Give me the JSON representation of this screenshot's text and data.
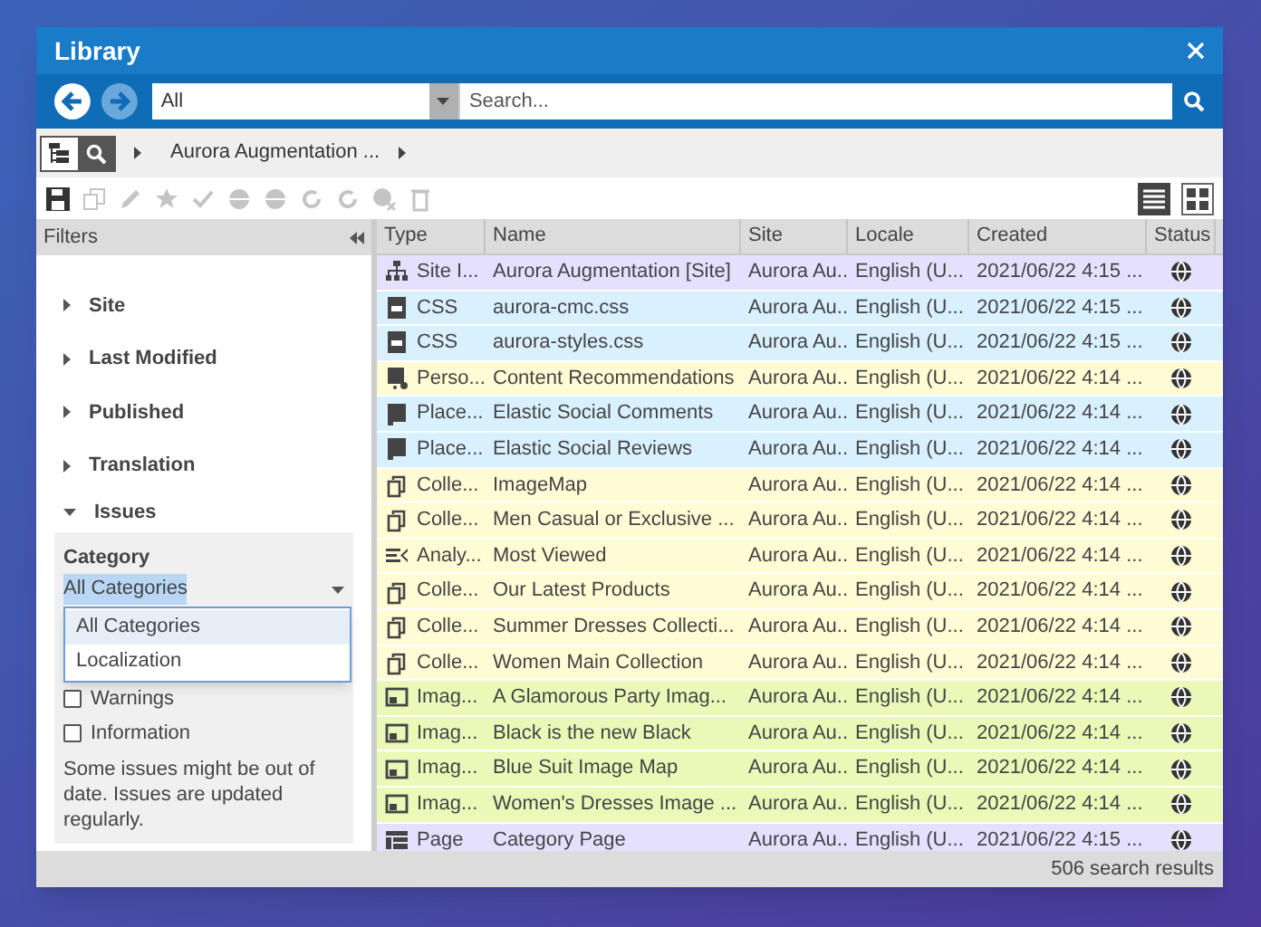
{
  "window": {
    "title": "Library"
  },
  "nav": {
    "type_filter": "All",
    "search": {
      "placeholder": "Search..."
    }
  },
  "breadcrumb": [
    "Aurora Augmentation ..."
  ],
  "filters": {
    "title": "Filters",
    "sections": [
      {
        "label": "Site",
        "expanded": false
      },
      {
        "label": "Last Modified",
        "expanded": false
      },
      {
        "label": "Published",
        "expanded": false
      },
      {
        "label": "Translation",
        "expanded": false
      },
      {
        "label": "Issues",
        "expanded": true
      }
    ],
    "issues": {
      "category_label": "Category",
      "category_value": "All Categories",
      "dropdown_options": [
        {
          "label": "All Categories",
          "selected": true
        },
        {
          "label": "Localization",
          "selected": false
        }
      ],
      "checkboxes": [
        {
          "label": "Warnings",
          "checked": false
        },
        {
          "label": "Information",
          "checked": false
        }
      ],
      "note": "Some issues might be out of date. Issues are updated regularly."
    }
  },
  "table": {
    "columns": [
      "Type",
      "Name",
      "Site",
      "Locale",
      "Created",
      "Status"
    ],
    "rows": [
      {
        "kind": "site",
        "color": "#e6e0ff",
        "cells": [
          "Site I...",
          "Aurora Augmentation [Site]",
          "Aurora Au...",
          "English (U...",
          "2021/06/22 4:15 ..."
        ]
      },
      {
        "kind": "css",
        "color": "#d9f0ff",
        "cells": [
          "CSS",
          "aurora-cmc.css",
          "Aurora Au...",
          "English (U...",
          "2021/06/22 4:15 ..."
        ]
      },
      {
        "kind": "css",
        "color": "#d9f0ff",
        "cells": [
          "CSS",
          "aurora-styles.css",
          "Aurora Au...",
          "English (U...",
          "2021/06/22 4:15 ..."
        ]
      },
      {
        "kind": "personalization",
        "color": "#fffbd4",
        "cells": [
          "Perso...",
          "Content Recommendations",
          "Aurora Au...",
          "English (U...",
          "2021/06/22 4:14 ..."
        ]
      },
      {
        "kind": "placement",
        "color": "#d9f0ff",
        "cells": [
          "Place...",
          "Elastic Social Comments",
          "Aurora Au...",
          "English (U...",
          "2021/06/22 4:14 ..."
        ]
      },
      {
        "kind": "placement",
        "color": "#d9f0ff",
        "cells": [
          "Place...",
          "Elastic Social Reviews",
          "Aurora Au...",
          "English (U...",
          "2021/06/22 4:14 ..."
        ]
      },
      {
        "kind": "collection",
        "color": "#fffbd4",
        "cells": [
          "Colle...",
          "ImageMap",
          "Aurora Au...",
          "English (U...",
          "2021/06/22 4:14 ..."
        ]
      },
      {
        "kind": "collection",
        "color": "#fffbd4",
        "cells": [
          "Colle...",
          "Men Casual or Exclusive ...",
          "Aurora Au...",
          "English (U...",
          "2021/06/22 4:14 ..."
        ]
      },
      {
        "kind": "analytics",
        "color": "#fffbd4",
        "cells": [
          "Analy...",
          "Most Viewed",
          "Aurora Au...",
          "English (U...",
          "2021/06/22 4:14 ..."
        ]
      },
      {
        "kind": "collection",
        "color": "#fffbd4",
        "cells": [
          "Colle...",
          "Our Latest Products",
          "Aurora Au...",
          "English (U...",
          "2021/06/22 4:14 ..."
        ]
      },
      {
        "kind": "collection",
        "color": "#fffbd4",
        "cells": [
          "Colle...",
          "Summer Dresses Collecti...",
          "Aurora Au...",
          "English (U...",
          "2021/06/22 4:14 ..."
        ]
      },
      {
        "kind": "collection",
        "color": "#fffbd4",
        "cells": [
          "Colle...",
          "Women Main Collection",
          "Aurora Au...",
          "English (U...",
          "2021/06/22 4:14 ..."
        ]
      },
      {
        "kind": "image",
        "color": "#ebf8b8",
        "cells": [
          "Imag...",
          "A Glamorous Party Imag...",
          "Aurora Au...",
          "English (U...",
          "2021/06/22 4:14 ..."
        ]
      },
      {
        "kind": "image",
        "color": "#ebf8b8",
        "cells": [
          "Imag...",
          "Black is the new Black",
          "Aurora Au...",
          "English (U...",
          "2021/06/22 4:14 ..."
        ]
      },
      {
        "kind": "image",
        "color": "#ebf8b8",
        "cells": [
          "Imag...",
          "Blue Suit Image Map",
          "Aurora Au...",
          "English (U...",
          "2021/06/22 4:14 ..."
        ]
      },
      {
        "kind": "image",
        "color": "#ebf8b8",
        "cells": [
          "Imag...",
          "Women's Dresses Image ...",
          "Aurora Au...",
          "English (U...",
          "2021/06/22 4:14 ..."
        ]
      },
      {
        "kind": "page",
        "color": "#e6e0ff",
        "cells": [
          "Page",
          "Category Page",
          "Aurora Au...",
          "English (U...",
          "2021/06/22 4:15 ..."
        ]
      }
    ]
  },
  "status_bar": "506 search results"
}
